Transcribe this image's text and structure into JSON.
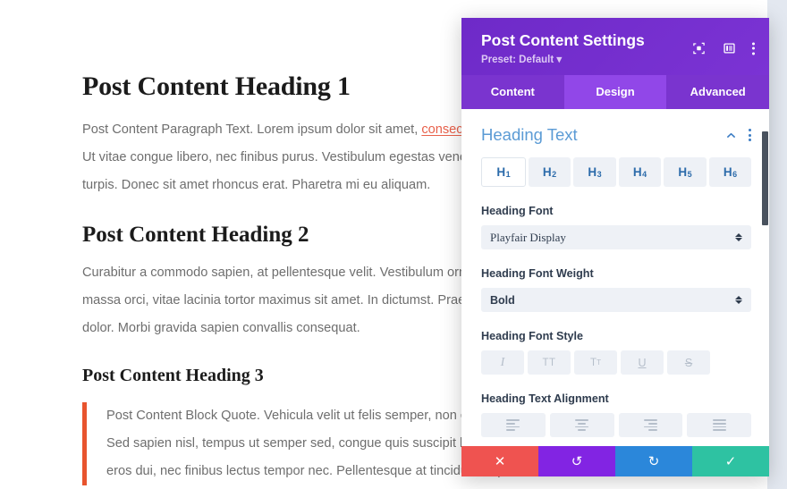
{
  "article": {
    "heading1": "Post Content Heading 1",
    "paragraph1_pre": "Post Content Paragraph Text. Lorem ipsum dolor sit amet, ",
    "paragraph1_link": "consectetur adipiscing elit",
    "paragraph1_post": ". Ut vitae congue libero, nec finibus purus. Vestibulum egestas venenatis. Sed et ultricies turpis. Donec sit amet rhoncus erat. Pharetra mi eu aliquam.",
    "heading2": "Post Content Heading 2",
    "paragraph2": "Curabitur a commodo sapien, at pellentesque velit. Vestibulum ornare. Mauris tempus massa orci, vitae lacinia tortor maximus sit amet. In dictumst. Praesent id tincidunt dolor. Morbi gravida sapien convallis consequat.",
    "heading3": "Post Content Heading 3",
    "blockquote": "Post Content Block Quote. Vehicula velit ut felis semper, non commodo fermentum. Sed sapien nisl, tempus ut semper sed, congue quis suscipit lacus. Duis luctus eros dui, nec finibus lectus tempor nec. Pellentesque at tincidunt turpis."
  },
  "modal": {
    "title": "Post Content Settings",
    "preset": "Preset: Default ▾",
    "header_icons": [
      {
        "name": "focus-target-icon"
      },
      {
        "name": "layout-panel-icon"
      },
      {
        "name": "more-options-icon"
      }
    ],
    "tabs": [
      {
        "label": "Content",
        "active": false
      },
      {
        "label": "Design",
        "active": true
      },
      {
        "label": "Advanced",
        "active": false
      }
    ],
    "section": {
      "title": "Heading Text",
      "collapse_icon": "chevron-up-icon",
      "options_icon": "more-options-icon"
    },
    "heading_levels": [
      {
        "label": "H",
        "sub": "1",
        "active": true
      },
      {
        "label": "H",
        "sub": "2",
        "active": false
      },
      {
        "label": "H",
        "sub": "3",
        "active": false
      },
      {
        "label": "H",
        "sub": "4",
        "active": false
      },
      {
        "label": "H",
        "sub": "5",
        "active": false
      },
      {
        "label": "H",
        "sub": "6",
        "active": false
      }
    ],
    "fields": {
      "font_label": "Heading Font",
      "font_value": "Playfair Display",
      "weight_label": "Heading Font Weight",
      "weight_value": "Bold",
      "style_label": "Heading Font Style",
      "alignment_label": "Heading Text Alignment"
    },
    "font_styles": [
      {
        "glyph": "I",
        "name": "italic"
      },
      {
        "glyph": "TT",
        "name": "uppercase"
      },
      {
        "glyph": "T",
        "sub": "T",
        "name": "small-caps"
      },
      {
        "glyph": "U",
        "name": "underline"
      },
      {
        "glyph": "S",
        "name": "strikethrough"
      }
    ],
    "alignments": [
      {
        "name": "align-left"
      },
      {
        "name": "align-center"
      },
      {
        "name": "align-right"
      },
      {
        "name": "align-justify"
      }
    ],
    "actions": [
      {
        "name": "discard-button",
        "glyph": "✕",
        "color": "#ef5350"
      },
      {
        "name": "undo-button",
        "glyph": "↺",
        "color": "#8224e3"
      },
      {
        "name": "redo-button",
        "glyph": "↻",
        "color": "#2b87da"
      },
      {
        "name": "save-button",
        "glyph": "✓",
        "color": "#2ec2a2"
      }
    ]
  }
}
